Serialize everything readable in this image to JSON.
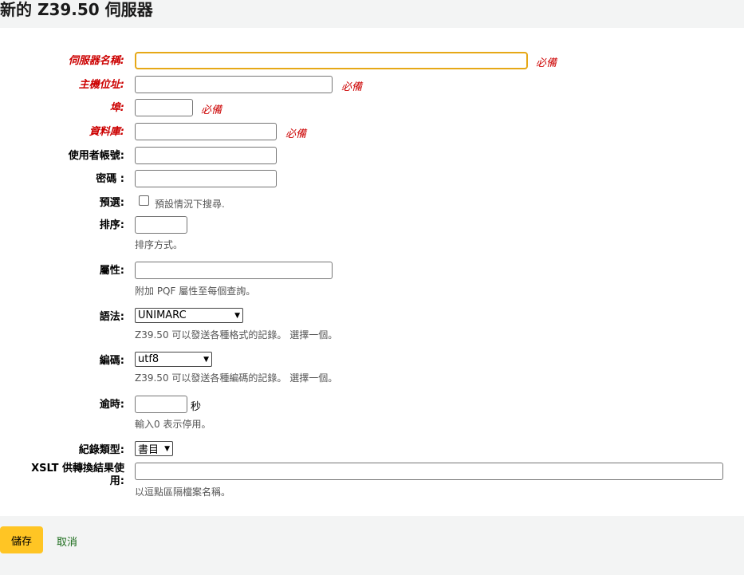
{
  "page": {
    "title": "新的 Z39.50 伺服器"
  },
  "form": {
    "required_note": "必備",
    "server_name": {
      "label": "伺服器名稱:"
    },
    "host": {
      "label": "主機位址:"
    },
    "port": {
      "label": "埠:"
    },
    "database": {
      "label": "資料庫:"
    },
    "userid": {
      "label": "使用者帳號:"
    },
    "password": {
      "label": "密碼 :"
    },
    "preselected": {
      "label": "預選:",
      "checkbox_label": "預設情況下搜尋."
    },
    "rank": {
      "label": "排序:",
      "hint": "排序方式。"
    },
    "attributes": {
      "label": "屬性:",
      "hint": "附加 PQF 屬性至每個查詢。"
    },
    "syntax": {
      "label": "語法:",
      "selected": "UNIMARC",
      "hint": "Z39.50 可以發送各種格式的記錄。 選擇一個。"
    },
    "encoding": {
      "label": "編碼:",
      "selected": "utf8",
      "hint": "Z39.50 可以發送各種編碼的記錄。 選擇一個。"
    },
    "timeout": {
      "label": "逾時:",
      "unit": "秒",
      "hint": "輸入0 表示停用。"
    },
    "record_type": {
      "label": "紀錄類型:",
      "selected": "書目"
    },
    "xslt": {
      "label": "XSLT 供轉換結果使用:",
      "hint": "以逗點區隔檔案名稱。"
    }
  },
  "actions": {
    "save_label": "儲存",
    "cancel_label": "取消"
  }
}
